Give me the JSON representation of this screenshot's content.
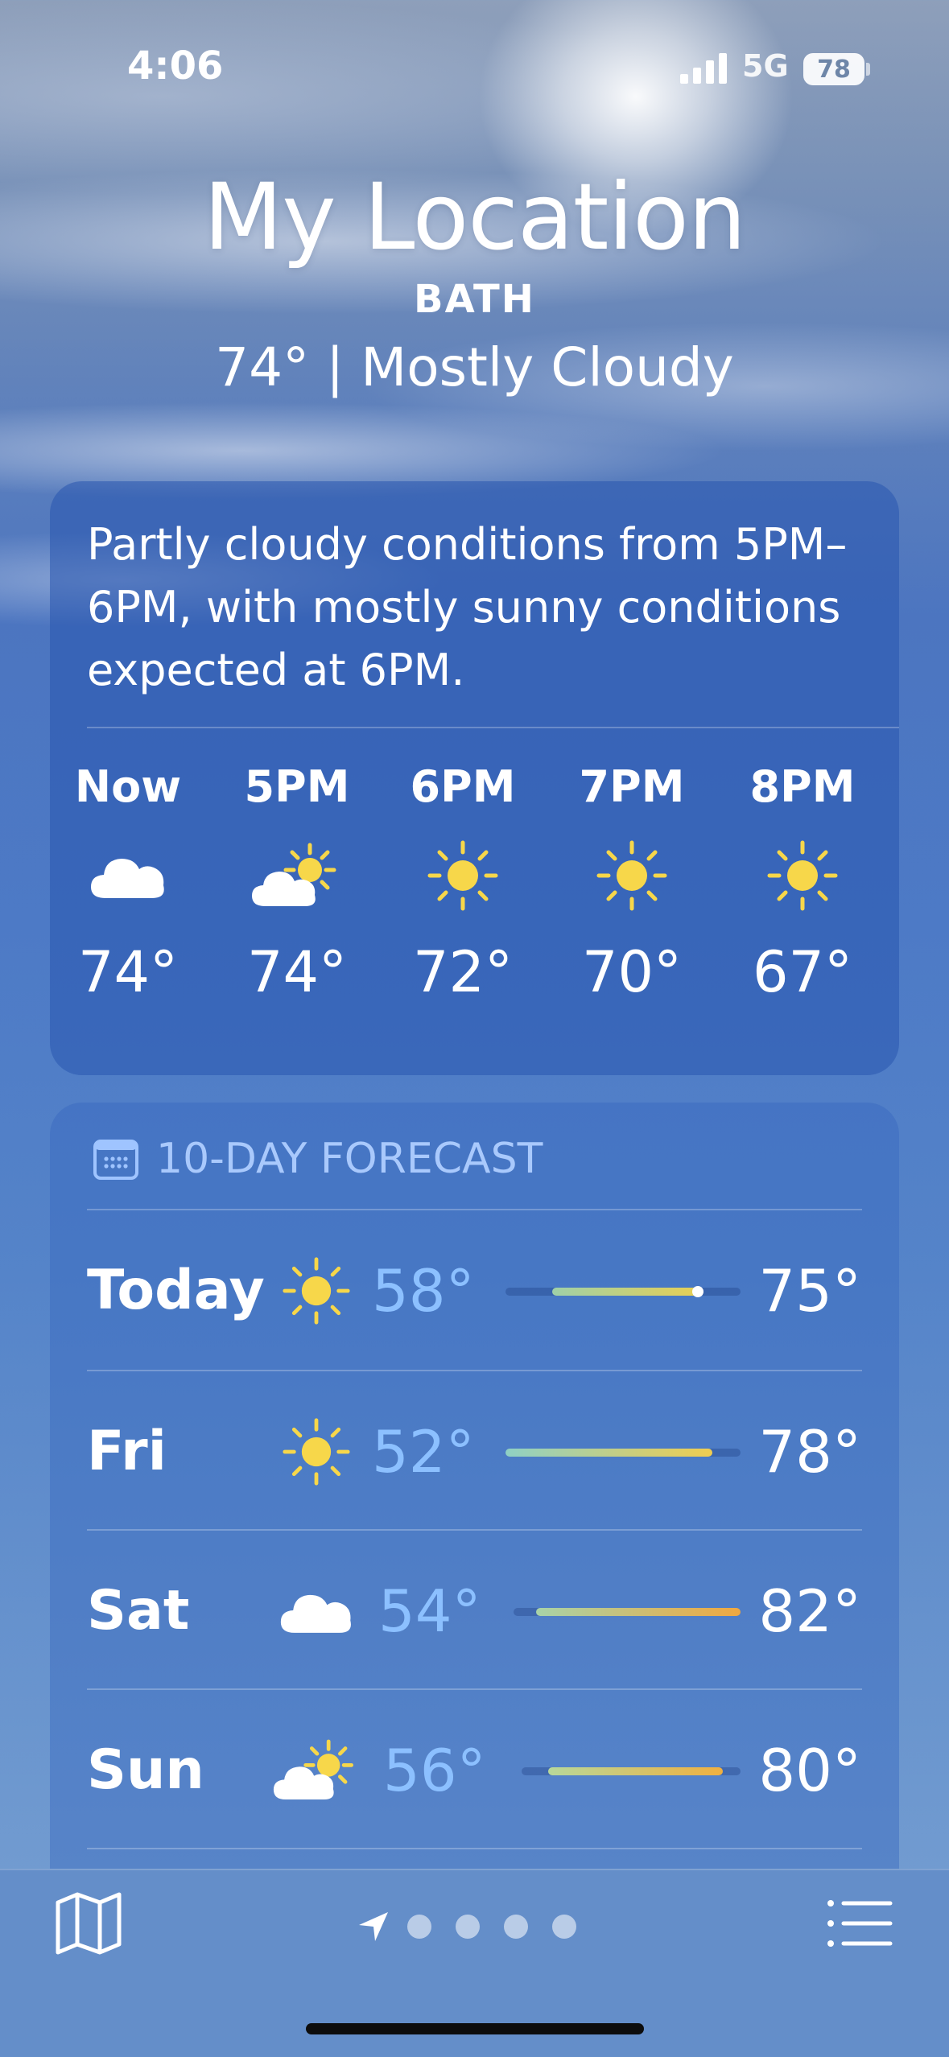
{
  "status_bar": {
    "time": "4:06",
    "network": "5G",
    "battery": "78"
  },
  "header": {
    "location": "My Location",
    "city": "BATH",
    "condition": "74° | Mostly Cloudy"
  },
  "hourly": {
    "summary": "Partly cloudy conditions from 5PM–6PM, with mostly sunny conditions expected at 6PM.",
    "hours": [
      {
        "label": "Now",
        "icon": "cloud-icon",
        "temp": "74°"
      },
      {
        "label": "5PM",
        "icon": "partly-sunny-icon",
        "temp": "74°"
      },
      {
        "label": "6PM",
        "icon": "sun-icon",
        "temp": "72°"
      },
      {
        "label": "7PM",
        "icon": "sun-icon",
        "temp": "70°"
      },
      {
        "label": "8PM",
        "icon": "sun-icon",
        "temp": "67°"
      }
    ]
  },
  "forecast": {
    "title": "10-DAY FORECAST",
    "days": [
      {
        "day": "Today",
        "icon": "sun-icon",
        "low": "58°",
        "high": "75°",
        "range_start": 0.2,
        "range_end": 0.82,
        "current": 0.82,
        "colors": [
          "#9fd0a8",
          "#e6cf55"
        ]
      },
      {
        "day": "Fri",
        "icon": "sun-icon",
        "low": "52°",
        "high": "78°",
        "range_start": 0.0,
        "range_end": 0.88,
        "colors": [
          "#8fd0c4",
          "#f0cd50"
        ]
      },
      {
        "day": "Sat",
        "icon": "cloud-icon",
        "low": "54°",
        "high": "82°",
        "range_start": 0.1,
        "range_end": 1.0,
        "colors": [
          "#a8d3a8",
          "#f0a840"
        ]
      },
      {
        "day": "Sun",
        "icon": "partly-sunny-icon",
        "low": "56°",
        "high": "80°",
        "range_start": 0.12,
        "range_end": 0.92,
        "colors": [
          "#b8d89a",
          "#f0b040"
        ]
      }
    ]
  },
  "bottom_bar": {
    "pages": 4
  }
}
